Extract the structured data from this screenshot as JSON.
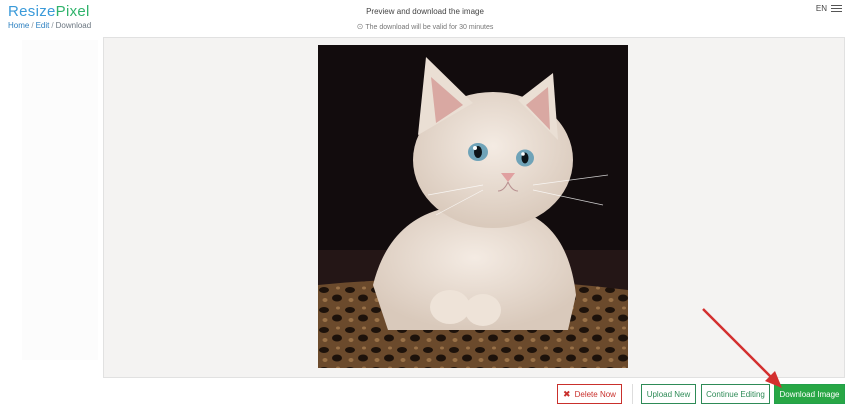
{
  "header": {
    "logo_part1": "Resize",
    "logo_part2": "Pixel",
    "title": "Preview and download the image",
    "notice": "The download will be valid for 30 minutes",
    "language": "EN"
  },
  "breadcrumb": {
    "items": [
      "Home",
      "Edit",
      "Download"
    ]
  },
  "actions": {
    "delete_label": "Delete Now",
    "upload_label": "Upload New",
    "continue_label": "Continue Editing",
    "download_label": "Download Image"
  },
  "colors": {
    "logo_blue": "#3a9ad9",
    "logo_green": "#2fb36b",
    "delete_red": "#c9302c",
    "action_green": "#2e8b57",
    "download_green": "#28a745",
    "annotation_arrow": "#d32f2f"
  },
  "icons": {
    "menu": "hamburger-icon",
    "clock": "clock-icon",
    "delete": "x-icon"
  }
}
